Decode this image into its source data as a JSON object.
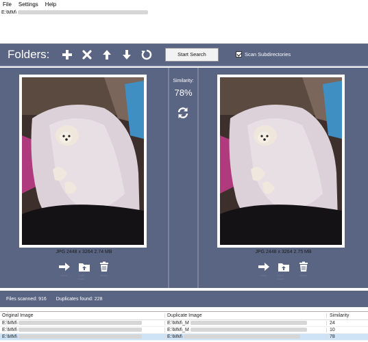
{
  "menu": {
    "items": [
      "File",
      "Settings",
      "Help"
    ]
  },
  "path": {
    "value": "E:\\MM\\"
  },
  "toolbar": {
    "folders_label": "Folders:",
    "start_label": "Start Search",
    "scan_label": "Scan Subdirectories",
    "scan_checked": true
  },
  "left_image": {
    "info": "JPG  2448 x 3264  2.74 MB"
  },
  "right_image": {
    "info": "JPG  2448 x 3264  2.75 MB"
  },
  "actions": {
    "move": "move",
    "open": "Open folder",
    "delete": "delete"
  },
  "center": {
    "similarity_label": "Similarity:",
    "similarity_value": "78%"
  },
  "status": {
    "scanned": "Files scanned: 916",
    "duplicates": "Duplicates found: 228"
  },
  "results": {
    "headers": [
      "Original Image",
      "Duplicate Image",
      "Similarity"
    ],
    "rows": [
      {
        "original": "E:\\MM\\",
        "duplicate": "E:\\MM\\_M",
        "similarity": "24"
      },
      {
        "original": "E:\\MM\\",
        "duplicate": "E:\\MM\\_M",
        "similarity": "10"
      },
      {
        "original": "E:\\MM\\",
        "duplicate": "E:\\MM\\",
        "similarity": "78"
      }
    ]
  },
  "colors": {
    "panel": "#5a6583",
    "accent": "#ffffff"
  }
}
